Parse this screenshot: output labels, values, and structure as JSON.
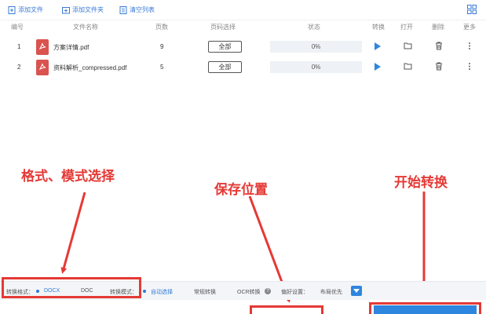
{
  "toolbar": {
    "add_file": "添加文件",
    "add_folder": "添加文件夹",
    "clear_list": "清空列表"
  },
  "table": {
    "headers": {
      "index": "编号",
      "name": "文件名称",
      "pages": "页数",
      "page_select": "页码选择",
      "status": "状态",
      "convert": "转换",
      "open": "打开",
      "delete": "删除",
      "more": "更多"
    },
    "rows": [
      {
        "index": "1",
        "name": "方案详情.pdf",
        "pages": "9",
        "page_select": "全部",
        "progress": "0%"
      },
      {
        "index": "2",
        "name": "资料解析_compressed.pdf",
        "pages": "5",
        "page_select": "全部",
        "progress": "0%"
      }
    ]
  },
  "annotations": {
    "format": "格式、模式选择",
    "save": "保存位置",
    "start": "开始转换"
  },
  "bottombar": {
    "format_label": "转换格式：",
    "format_docx": "DOCX",
    "format_doc": "DOC",
    "mode_label": "转换模式：",
    "mode_sel": "自动选择",
    "mode_normal": "常规转换",
    "mode_ocr": "OCR转换",
    "pref_label": "偏好设置：",
    "pref_value": "布局优先"
  },
  "colors": {
    "accent": "#2e86de",
    "annotation": "#e53935",
    "pdf": "#d9534f"
  }
}
